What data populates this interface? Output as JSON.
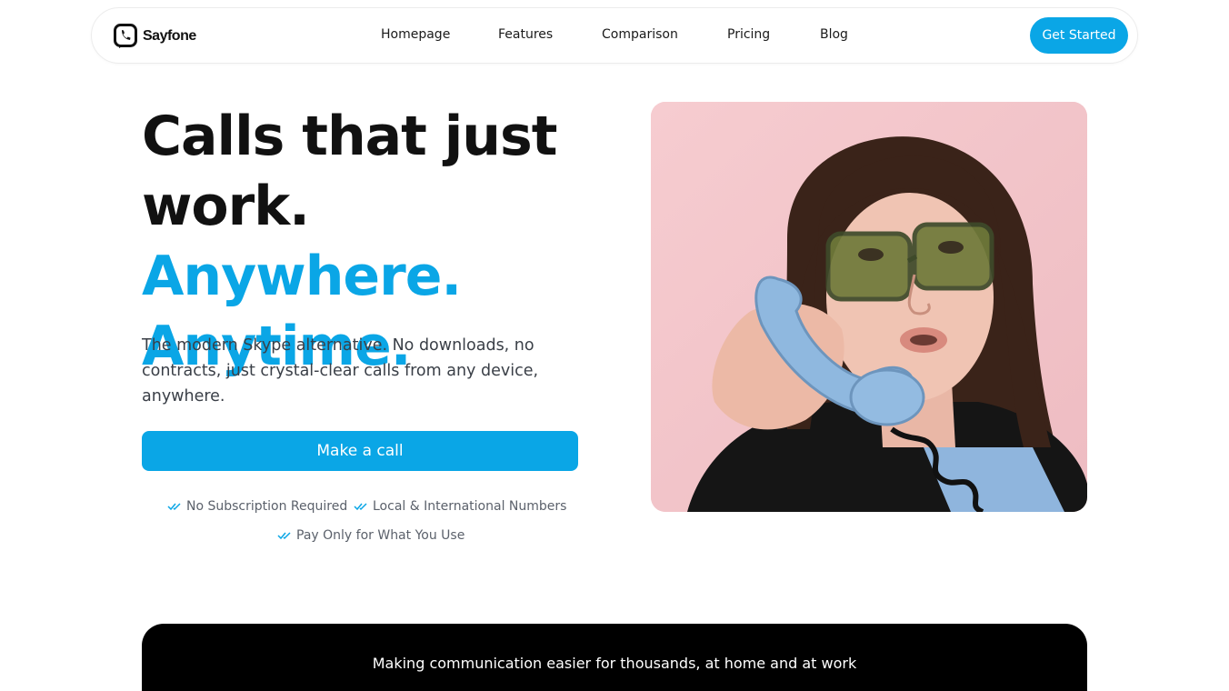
{
  "nav": {
    "brand": "Sayfone",
    "links": [
      "Homepage",
      "Features",
      "Comparison",
      "Pricing",
      "Blog"
    ],
    "cta": "Get Started"
  },
  "hero": {
    "headline_line1": "Calls that just",
    "headline_line2_plain": "work.",
    "headline_line2_accent": "Anywhere.",
    "headline_line3_accent": "Anytime.",
    "subtext": "The modern Skype alternative. No downloads, no contracts, just crystal-clear calls from any device, anywhere.",
    "primary_button": "Make a call",
    "features": [
      "No Subscription Required",
      "Local & International Numbers",
      "Pay Only for What You Use"
    ],
    "image_icon": "woman-on-phone-photo"
  },
  "banner": {
    "text": "Making communication easier for thousands, at home and at work"
  },
  "colors": {
    "accent": "#0aa6e6",
    "text": "#111111",
    "muted": "#5b616b",
    "banner_bg": "#000000"
  }
}
